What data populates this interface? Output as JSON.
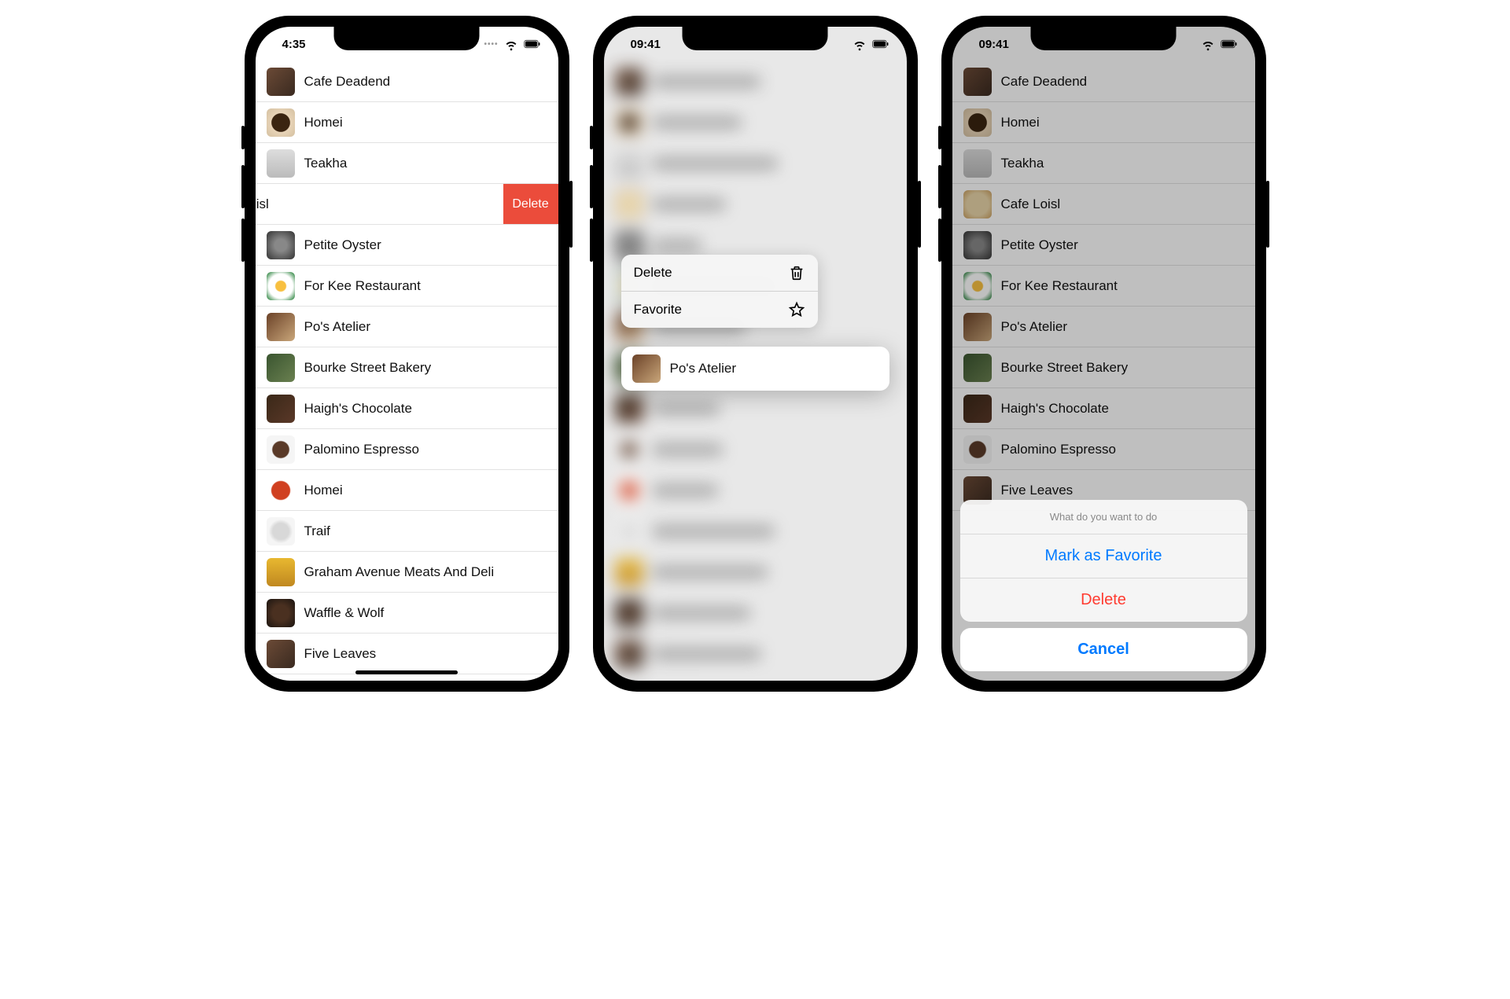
{
  "phone1": {
    "time": "4:35",
    "swipe_delete": "Delete",
    "swiped_label": "afe Loisl",
    "restaurants": [
      {
        "name": "Cafe Deadend",
        "thumb": "t-brown"
      },
      {
        "name": "Homei",
        "thumb": "t-coffee"
      },
      {
        "name": "Teakha",
        "thumb": "t-tea"
      },
      {
        "name": "Cafe Loisl",
        "thumb": "t-latte",
        "swiped": true
      },
      {
        "name": "Petite Oyster",
        "thumb": "t-oyster"
      },
      {
        "name": "For Kee Restaurant",
        "thumb": "t-egg"
      },
      {
        "name": "Po's Atelier",
        "thumb": "t-bread"
      },
      {
        "name": "Bourke Street Bakery",
        "thumb": "t-bakery"
      },
      {
        "name": "Haigh's Chocolate",
        "thumb": "t-choc"
      },
      {
        "name": "Palomino Espresso",
        "thumb": "t-espresso"
      },
      {
        "name": "Homei",
        "thumb": "t-bowl"
      },
      {
        "name": "Traif",
        "thumb": "t-plate"
      },
      {
        "name": "Graham Avenue Meats And Deli",
        "thumb": "t-fries"
      },
      {
        "name": "Waffle & Wolf",
        "thumb": "t-dark"
      },
      {
        "name": "Five Leaves",
        "thumb": "t-brown"
      }
    ]
  },
  "phone2": {
    "time": "09:41",
    "context_menu": {
      "delete": "Delete",
      "favorite": "Favorite"
    },
    "preview": {
      "name": "Po's Atelier",
      "thumb": "t-bread"
    }
  },
  "phone3": {
    "time": "09:41",
    "restaurants": [
      {
        "name": "Cafe Deadend",
        "thumb": "t-brown"
      },
      {
        "name": "Homei",
        "thumb": "t-coffee"
      },
      {
        "name": "Teakha",
        "thumb": "t-tea"
      },
      {
        "name": "Cafe Loisl",
        "thumb": "t-latte"
      },
      {
        "name": "Petite Oyster",
        "thumb": "t-oyster"
      },
      {
        "name": "For Kee Restaurant",
        "thumb": "t-egg"
      },
      {
        "name": "Po's Atelier",
        "thumb": "t-bread"
      },
      {
        "name": "Bourke Street Bakery",
        "thumb": "t-bakery"
      },
      {
        "name": "Haigh's Chocolate",
        "thumb": "t-choc"
      },
      {
        "name": "Palomino Espresso",
        "thumb": "t-espresso"
      },
      {
        "name": "Five Leaves",
        "thumb": "t-brown"
      }
    ],
    "action_sheet": {
      "title": "What do you want to do",
      "favorite": "Mark as Favorite",
      "delete": "Delete",
      "cancel": "Cancel"
    }
  }
}
